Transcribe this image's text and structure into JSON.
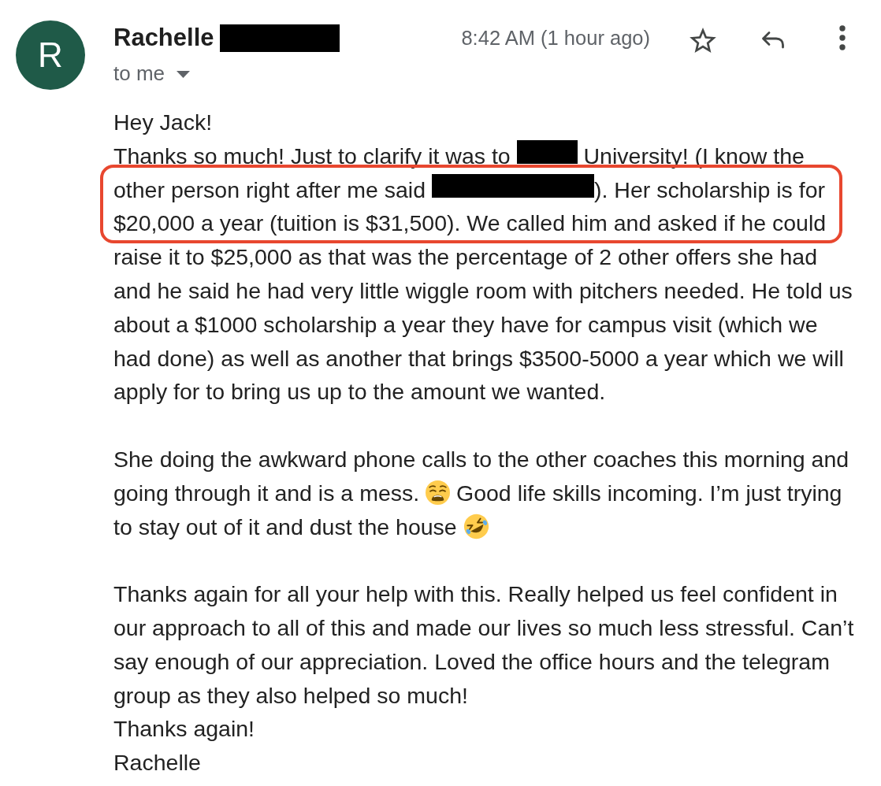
{
  "avatar": {
    "letter": "R"
  },
  "sender": {
    "name": "Rachelle",
    "surname_redacted": true
  },
  "recipient": {
    "label": "to me"
  },
  "time": "8:42 AM (1 hour ago)",
  "starred": false,
  "body": [
    {
      "lines": [
        [
          {
            "kind": "text",
            "text": "Hey Jack!"
          }
        ],
        [
          {
            "kind": "text",
            "text": "Thanks so much! Just to clarify it was to "
          },
          {
            "kind": "redaction"
          },
          {
            "kind": "text",
            "text": " University! (I know the "
          },
          {
            "kind": "text",
            "text": "other person right after me said "
          },
          {
            "kind": "redaction"
          },
          {
            "kind": "text",
            "text": "). Her scholarship is for "
          },
          {
            "kind": "text",
            "text": "$20,000 a year (tuition is $31,500). We called him and asked if he could raise it to $25,000 as that was the percentage of 2 other offers she had and he said he had very little wiggle room with pitchers needed. He told us about a $1000 scholarship a year they have for campus visit (which we had done) as well as another that brings $3500-5000 a year which we will apply for to bring us up to the amount we wanted."
          }
        ]
      ]
    },
    {
      "lines": [
        [
          {
            "kind": "text",
            "text": "She doing the awkward phone calls to the other coaches this morning and "
          },
          {
            "kind": "text",
            "text": "going through it and is a mess. "
          },
          {
            "kind": "weary"
          },
          {
            "kind": "text",
            "text": " Good life skills incoming. I’m just trying "
          },
          {
            "kind": "text",
            "text": "to stay out of it and dust the house "
          },
          {
            "kind": "rofl"
          }
        ]
      ]
    },
    {
      "lines": [
        [
          {
            "kind": "text",
            "text": "Thanks again for all your help with this. Really helped us feel confident in our approach to all of this and made our lives so much less stressful. Can’t say enough of our appreciation. Loved the office hours and the telegram group as they also helped so much!"
          }
        ],
        [
          {
            "kind": "text",
            "text": "Thanks again!"
          }
        ],
        [
          {
            "kind": "text",
            "text": "Rachelle"
          }
        ]
      ]
    }
  ]
}
